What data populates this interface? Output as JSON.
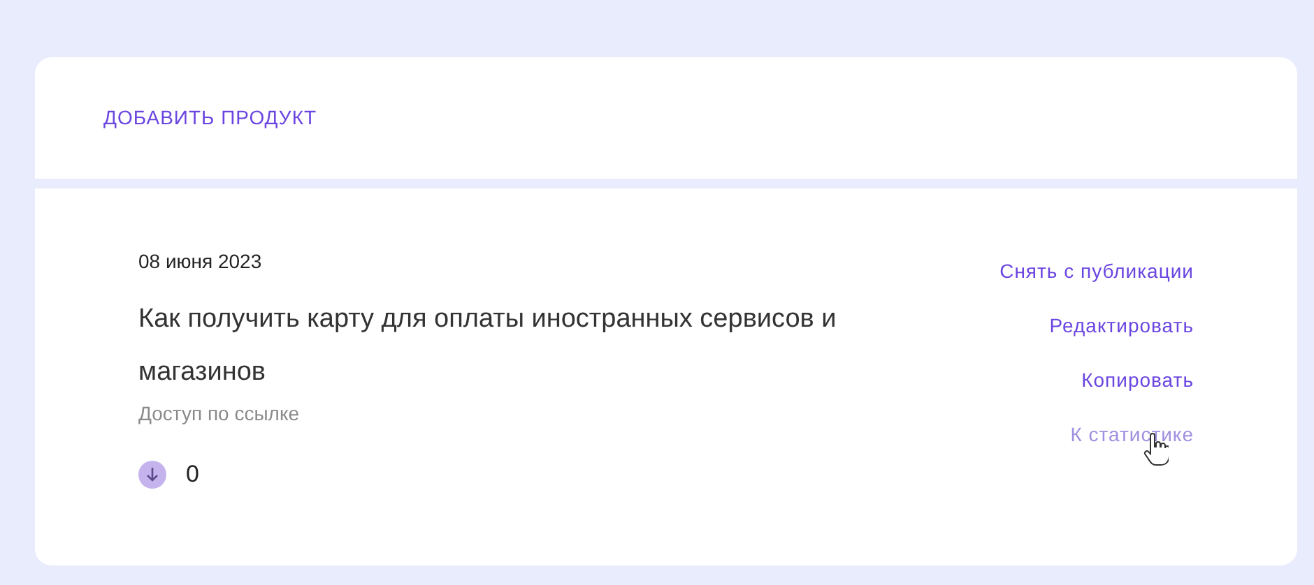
{
  "add_product": {
    "label": "ДОБАВИТЬ ПРОДУКТ"
  },
  "product": {
    "date": "08 июня 2023",
    "title": "Как получить карту для оплаты иностранных сервисов и магазинов",
    "access": "Доступ по ссылке",
    "count": "0",
    "actions": [
      {
        "label": "Снять с публикации",
        "hovered": false
      },
      {
        "label": "Редактировать",
        "hovered": false
      },
      {
        "label": "Копировать",
        "hovered": false
      },
      {
        "label": "К статистике",
        "hovered": true
      }
    ]
  }
}
